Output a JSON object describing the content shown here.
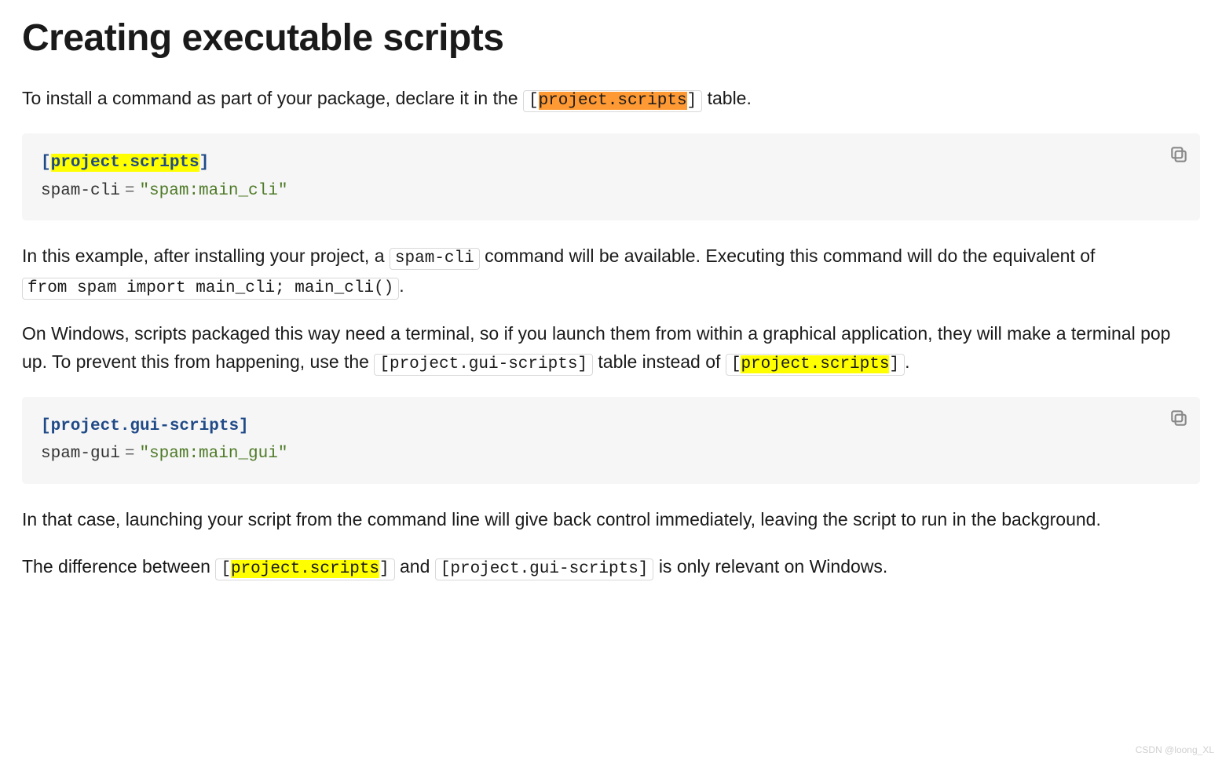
{
  "heading": "Creating executable scripts",
  "p1": {
    "pre": "To install a command as part of your package, declare it in the ",
    "code": "[project.scripts]",
    "code_inner": "project.scripts",
    "post": " table."
  },
  "block1": {
    "section": "[project.scripts]",
    "section_inner": "project.scripts",
    "key": "spam-cli",
    "op": "=",
    "value": "\"spam:main_cli\""
  },
  "p2": {
    "a": "In this example, after installing your project, a ",
    "code1": "spam-cli",
    "b": " command will be available. Executing this command will do the equivalent of ",
    "code2": "from spam import main_cli; main_cli()",
    "c": "."
  },
  "p3": {
    "a": "On Windows, scripts packaged this way need a terminal, so if you launch them from within a graphical application, they will make a terminal pop up. To prevent this from happening, use the ",
    "code1": "[project.gui-scripts]",
    "b": " table instead of ",
    "code2_open": "[",
    "code2_inner": "project.scripts",
    "code2_close": "]",
    "c": "."
  },
  "block2": {
    "section": "[project.gui-scripts]",
    "key": "spam-gui",
    "op": "=",
    "value": "\"spam:main_gui\""
  },
  "p4": "In that case, launching your script from the command line will give back control immediately, leaving the script to run in the background.",
  "p5": {
    "a": "The difference between ",
    "code1_open": "[",
    "code1_inner": "project.scripts",
    "code1_close": "]",
    "b": " and ",
    "code2": "[project.gui-scripts]",
    "c": " is only relevant on Windows."
  },
  "watermark": "CSDN @loong_XL"
}
